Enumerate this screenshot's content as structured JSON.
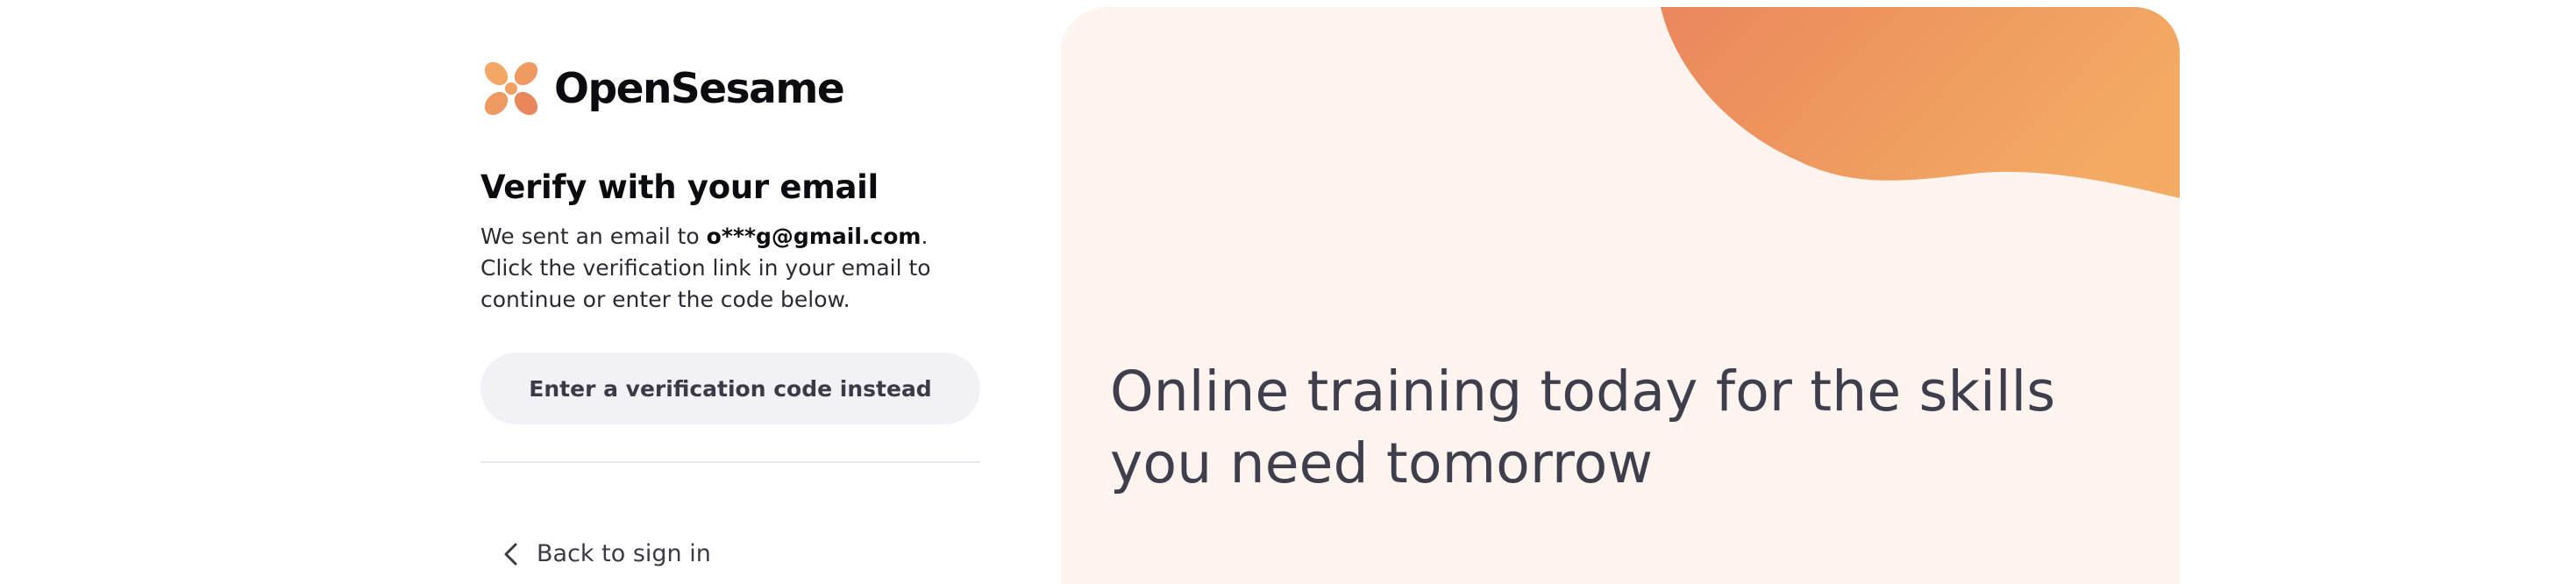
{
  "brand": {
    "name": "OpenSesame",
    "logo_icon": "opensesame-petal-logo-icon",
    "colors": {
      "logo_primary": "#F2A765",
      "logo_secondary": "#E9875C"
    }
  },
  "verify": {
    "title": "Verify with your email",
    "desc_prefix": "We sent an email to ",
    "email": "o***g@gmail.com",
    "desc_period": ".",
    "desc_rest": "Click the verification link in your email to continue or enter the code below."
  },
  "actions": {
    "code_button_label": "Enter a verification code instead",
    "back_label": "Back to sign in",
    "back_icon": "chevron-left-icon"
  },
  "hero": {
    "headline": "Online training today for the skills you need tomorrow",
    "colors": {
      "background": "#FDF4F0",
      "blob_start": "#EA875C",
      "blob_end": "#F3AA63"
    }
  }
}
